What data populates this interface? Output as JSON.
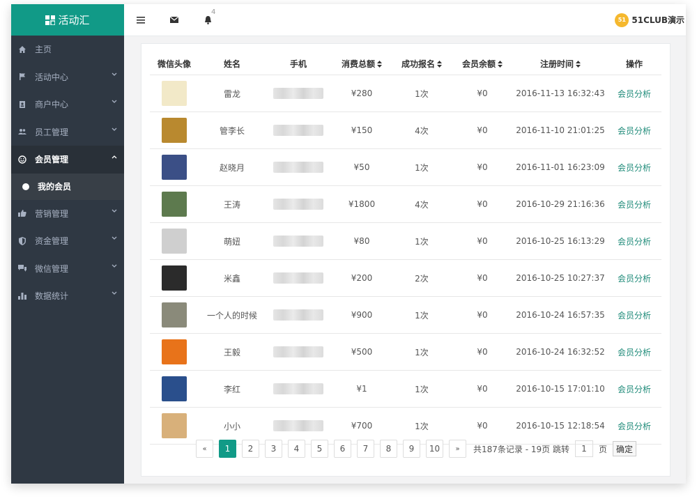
{
  "brand": {
    "name": "活动汇"
  },
  "header": {
    "bell_count": "4",
    "user_name": "51CLUB演示",
    "user_avatar_text": "51"
  },
  "sidebar": {
    "items": [
      {
        "label": "主页",
        "icon": "home-icon",
        "has_chevron": false
      },
      {
        "label": "活动中心",
        "icon": "flag-icon",
        "has_chevron": true
      },
      {
        "label": "商户中心",
        "icon": "contact-card-icon",
        "has_chevron": true
      },
      {
        "label": "员工管理",
        "icon": "users-icon",
        "has_chevron": true
      },
      {
        "label": "会员管理",
        "icon": "smile-icon",
        "has_chevron": true,
        "active": true
      },
      {
        "label": "营销管理",
        "icon": "thumbs-up-icon",
        "has_chevron": true
      },
      {
        "label": "资金管理",
        "icon": "shield-icon",
        "has_chevron": true
      },
      {
        "label": "微信管理",
        "icon": "chat-icon",
        "has_chevron": true
      },
      {
        "label": "数据统计",
        "icon": "bar-chart-icon",
        "has_chevron": true
      }
    ],
    "sub_item": "我的会员"
  },
  "table": {
    "headers": [
      "微信头像",
      "姓名",
      "手机",
      "消费总额",
      "成功报名",
      "会员余额",
      "注册时间",
      "操作"
    ],
    "rows": [
      {
        "name": "雷龙",
        "total": "¥280",
        "signups": "1次",
        "balance": "¥0",
        "registered": "2016-11-13 16:32:43",
        "action": "会员分析",
        "avatar_color": "#f2e9c8"
      },
      {
        "name": "管李长",
        "total": "¥150",
        "signups": "4次",
        "balance": "¥0",
        "registered": "2016-11-10 21:01:25",
        "action": "会员分析",
        "avatar_color": "#b9892f"
      },
      {
        "name": "赵晓月",
        "total": "¥50",
        "signups": "1次",
        "balance": "¥0",
        "registered": "2016-11-01 16:23:09",
        "action": "会员分析",
        "avatar_color": "#3b4f86"
      },
      {
        "name": "王涛",
        "total": "¥1800",
        "signups": "4次",
        "balance": "¥0",
        "registered": "2016-10-29 21:16:36",
        "action": "会员分析",
        "avatar_color": "#5d7a4e"
      },
      {
        "name": "萌妞",
        "total": "¥80",
        "signups": "1次",
        "balance": "¥0",
        "registered": "2016-10-25 16:13:29",
        "action": "会员分析",
        "avatar_color": "#cfcfcf"
      },
      {
        "name": "米鑫",
        "total": "¥200",
        "signups": "2次",
        "balance": "¥0",
        "registered": "2016-10-25 10:27:37",
        "action": "会员分析",
        "avatar_color": "#2b2b2b"
      },
      {
        "name": "一个人的时候",
        "total": "¥900",
        "signups": "1次",
        "balance": "¥0",
        "registered": "2016-10-24 16:57:35",
        "action": "会员分析",
        "avatar_color": "#8a8a7a"
      },
      {
        "name": "王毅",
        "total": "¥500",
        "signups": "1次",
        "balance": "¥0",
        "registered": "2016-10-24 16:32:52",
        "action": "会员分析",
        "avatar_color": "#e8731a"
      },
      {
        "name": "李红",
        "total": "¥1",
        "signups": "1次",
        "balance": "¥0",
        "registered": "2016-10-15 17:01:10",
        "action": "会员分析",
        "avatar_color": "#2a4f8c"
      },
      {
        "name": "小小",
        "total": "¥700",
        "signups": "1次",
        "balance": "¥0",
        "registered": "2016-10-15 12:18:54",
        "action": "会员分析",
        "avatar_color": "#d8b07a"
      }
    ]
  },
  "pagination": {
    "prev": "«",
    "next": "»",
    "pages": [
      "1",
      "2",
      "3",
      "4",
      "5",
      "6",
      "7",
      "8",
      "9",
      "10"
    ],
    "current": "1",
    "summary": "共187条记录 - 19页 跳转",
    "jump_value": "1",
    "page_unit": "页",
    "confirm": "确定"
  },
  "colors": {
    "accent": "#119a87",
    "sidebar": "#2f3843",
    "link": "#1d8a78"
  }
}
